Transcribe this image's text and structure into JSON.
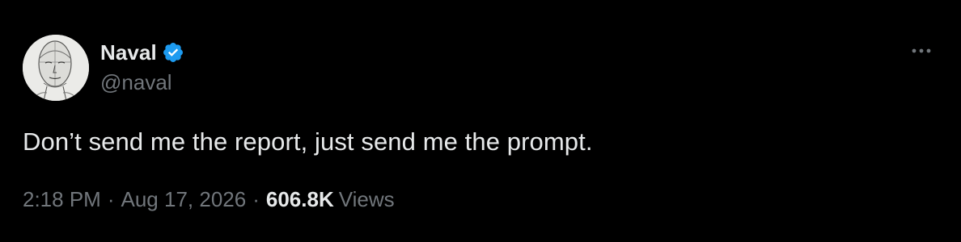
{
  "tweet": {
    "author": {
      "display_name": "Naval",
      "handle": "@naval",
      "verified": true,
      "verified_color": "#1d9bf0"
    },
    "text": "Don’t send me the report, just send me the prompt.",
    "meta": {
      "time": "2:18 PM",
      "separator": "·",
      "date": "Aug 17, 2026",
      "views_count": "606.8K",
      "views_label": "Views"
    },
    "icons": {
      "verified": "verified-badge-icon",
      "more": "more-options-icon"
    }
  },
  "colors": {
    "background": "#000000",
    "primary_text": "#e7e9ea",
    "secondary_text": "#71767b",
    "accent": "#1d9bf0"
  }
}
